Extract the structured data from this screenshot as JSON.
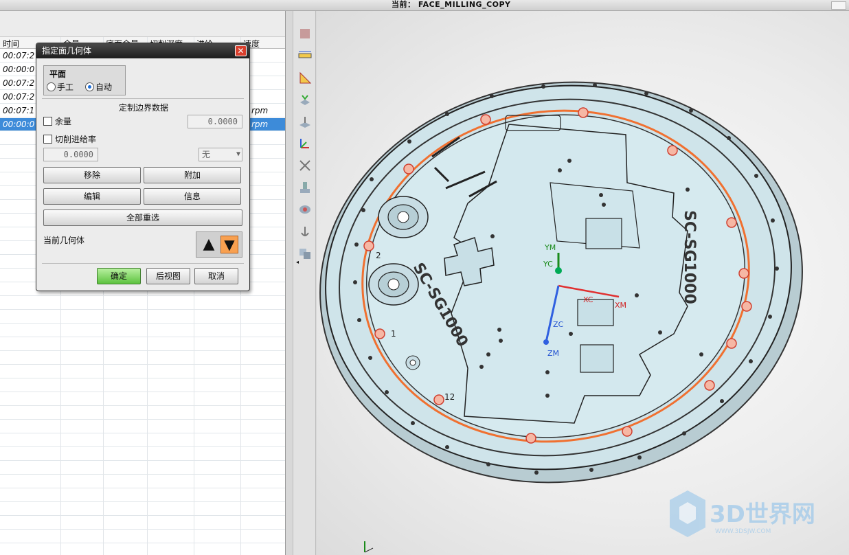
{
  "topbar": {
    "current_label": "当前： FACE_MILLING_COPY"
  },
  "oplist": {
    "headers": [
      "时间",
      "余量",
      "底面余量",
      "切削深度",
      "进给",
      "速度"
    ],
    "rows": [
      {
        "time": "00:07:2",
        "speed": ""
      },
      {
        "time": "00:00:0",
        "speed": ""
      },
      {
        "time": "00:07:2",
        "speed": ""
      },
      {
        "time": "00:07:2",
        "speed": ""
      },
      {
        "time": "00:07:1",
        "speed": "rpm"
      },
      {
        "time": "00:00:0",
        "speed": "rpm",
        "selected": true
      }
    ]
  },
  "dialog": {
    "title": "指定面几何体",
    "close_icon": "close-icon",
    "plane_group_title": "平面",
    "radio_manual": "手工",
    "radio_auto": "自动",
    "custom_boundary_label": "定制边界数据",
    "stock_label": "余量",
    "stock_value": "0.0000",
    "cut_feed_label": "切削进给率",
    "feed_value": "0.0000",
    "feed_unit_select": "无",
    "remove_btn": "移除",
    "append_btn": "附加",
    "edit_btn": "编辑",
    "info_btn": "信息",
    "reselect_all_btn": "全部重选",
    "current_geometry_label": "当前几何体",
    "ok_btn": "确定",
    "back_btn": "后视图",
    "cancel_btn": "取消"
  },
  "viewport": {
    "part_text_1": "SC-SG1000",
    "part_text_2": "SC-SG1000",
    "axis_labels": {
      "ym": "YM",
      "yc": "YC",
      "xc": "XC",
      "xm": "XM",
      "zc": "ZC",
      "zm": "ZM"
    },
    "marks": {
      "m1": "1",
      "m2": "2",
      "m12": "12"
    },
    "watermark": "3D世界网",
    "watermark_sub": "WWW.3DSJW.COM"
  },
  "colors": {
    "selection_blue": "#3d8bd9",
    "part_fill": "#cfe4ea",
    "boundary_orange": "#f07030",
    "ok_green": "#5cc23e"
  }
}
